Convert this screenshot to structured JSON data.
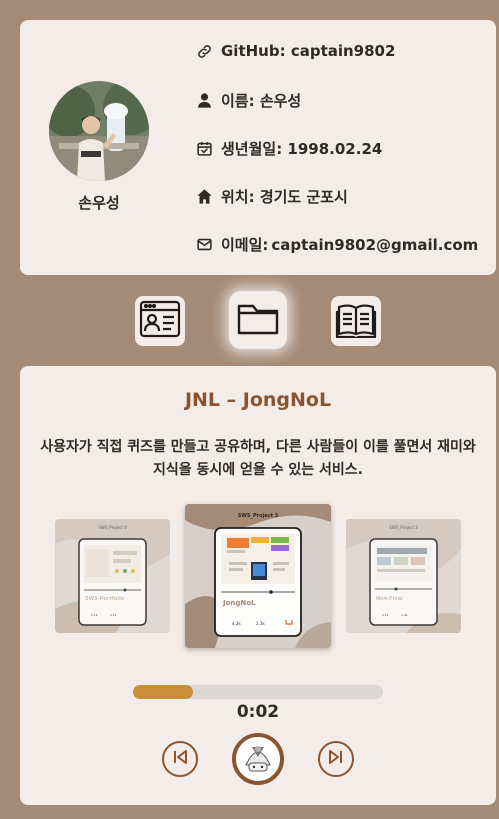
{
  "profile": {
    "name": "손우성",
    "github": "GitHub: captain9802",
    "name_row": "이름: 손우성",
    "birth": "생년월일: 1998.02.24",
    "location": "위치: 경기도 군포시",
    "email_label": "이메일:",
    "email": "captain9802@gmail.com"
  },
  "tabs": [
    {
      "icon": "profile-card-icon",
      "active": false
    },
    {
      "icon": "folder-icon",
      "active": true
    },
    {
      "icon": "book-icon",
      "active": false
    }
  ],
  "project": {
    "title": "JNL – JongNoL",
    "description": "사용자가 직접 퀴즈를 만들고 공유하며, 다른 사람들이 이를 풀면서 재미와 지식을 동시에 얻을 수 있는 서비스.",
    "slides": {
      "left": {
        "header": "SWS_Project 4",
        "name": "SWS-Portfolio",
        "likes": "1.1k",
        "comments": "1.1k"
      },
      "center": {
        "header": "SWS_Project 3",
        "name": "JongNoL",
        "likes": "4.2k",
        "comments": "2.1k"
      },
      "right": {
        "header": "SWS_Project 2",
        "name": "No4-Final",
        "likes": "1.1k",
        "comments": "1.4k"
      }
    }
  },
  "player": {
    "progress": 0.24,
    "time": "0:02"
  },
  "colors": {
    "background": "#a48b77",
    "card": "#f3ece8",
    "accent": "#8a542f",
    "progress": "#c98e3a"
  }
}
